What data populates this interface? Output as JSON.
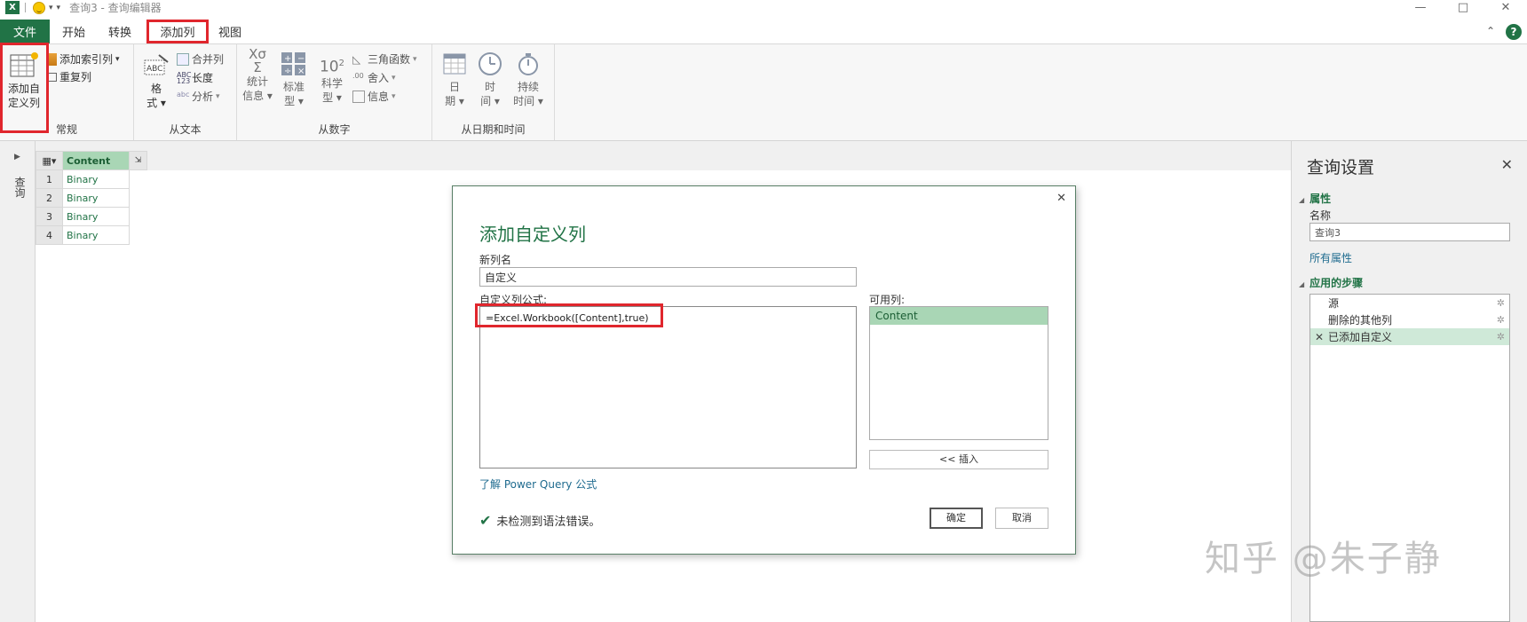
{
  "titlebar": {
    "app_icon": "X",
    "title": "查询3 - 查询编辑器",
    "dropdown": "▾",
    "minimize": "—",
    "restore": "□",
    "close": "✕"
  },
  "ribbon_tabs": [
    "文件",
    "开始",
    "转换",
    "添加列",
    "视图"
  ],
  "ribbon": {
    "general": {
      "add_custom_column": [
        "添加自",
        "定义列"
      ],
      "add_index_column": "添加索引列",
      "duplicate_column": "重复列",
      "label": "常规"
    },
    "from_text": {
      "format": [
        "格",
        "式"
      ],
      "merge_columns": "合并列",
      "length": "长度",
      "parse": "分析",
      "label": "从文本"
    },
    "from_number": {
      "statistics": [
        "统计",
        "信息"
      ],
      "standard": [
        "标准",
        "型"
      ],
      "scientific": [
        "科学",
        "型"
      ],
      "trig": "三角函数",
      "rounding": "舍入",
      "information": "信息",
      "label": "从数字"
    },
    "from_datetime": {
      "date": [
        "日",
        "期"
      ],
      "time": [
        "时",
        "间"
      ],
      "duration": [
        "持续",
        "时间"
      ],
      "label": "从日期和时间"
    }
  },
  "left_pane": {
    "label": "查询"
  },
  "grid": {
    "column": "Content",
    "rows": [
      {
        "num": "1",
        "value": "Binary"
      },
      {
        "num": "2",
        "value": "Binary"
      },
      {
        "num": "3",
        "value": "Binary"
      },
      {
        "num": "4",
        "value": "Binary"
      }
    ]
  },
  "dialog": {
    "title": "添加自定义列",
    "new_column_label": "新列名",
    "new_column_value": "自定义",
    "formula_label": "自定义列公式:",
    "formula_value": "=Excel.Workbook([Content],true)",
    "available_label": "可用列:",
    "available_columns": [
      "Content"
    ],
    "insert_button": "<< 插入",
    "learn_link": "了解 Power Query 公式",
    "status": "未检测到语法错误。",
    "ok_button": "确定",
    "cancel_button": "取消"
  },
  "query_settings": {
    "title": "查询设置",
    "properties_label": "属性",
    "name_label": "名称",
    "name_value": "查询3",
    "all_properties_link": "所有属性",
    "applied_steps_label": "应用的步骤",
    "steps": [
      {
        "label": "源",
        "active": false
      },
      {
        "label": "删除的其他列",
        "active": false
      },
      {
        "label": "已添加自定义",
        "active": true
      }
    ]
  },
  "watermark": "知乎 @朱子静",
  "colors": {
    "accent": "#217346",
    "highlight_border": "#e0262d",
    "selected_green": "#a9d6b5"
  }
}
